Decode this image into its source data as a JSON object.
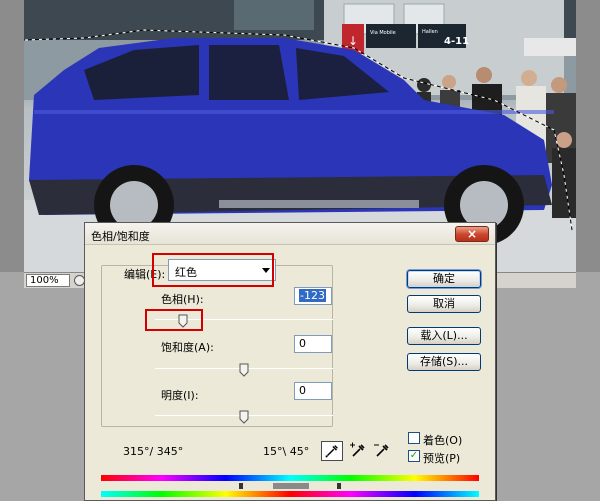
{
  "document": {
    "zoom": "100%",
    "scene": {
      "signs": [
        {
          "text": "Via Mobile"
        },
        {
          "text": "Hallen"
        },
        {
          "text": "4-11"
        }
      ],
      "car_color": "#2a35b8"
    }
  },
  "dialog": {
    "title": "色相/饱和度",
    "close_label": "×",
    "edit_label": "编辑(E):",
    "edit_value": "红色",
    "hue": {
      "label": "色相(H):",
      "value": "-123",
      "level": -123
    },
    "saturation": {
      "label": "饱和度(A):",
      "value": "0",
      "level": 0
    },
    "lightness": {
      "label": "明度(I):",
      "value": "0",
      "level": 0
    },
    "buttons": {
      "ok": "确定",
      "cancel": "取消",
      "load": "载入(L)...",
      "save": "存储(S)..."
    },
    "colorize": {
      "label": "着色(O)",
      "checked": false
    },
    "preview": {
      "label": "预览(P)",
      "checked": true
    },
    "range_left": "315°/ 345°",
    "range_right": "15°\\ 45°",
    "icons": [
      "eyedropper-icon",
      "eyedropper-plus-icon",
      "eyedropper-minus-icon"
    ]
  },
  "colors": {
    "dialog_bg": "#ece9d8",
    "highlight_red": "#d40000",
    "selection_blue": "#316ac5"
  }
}
